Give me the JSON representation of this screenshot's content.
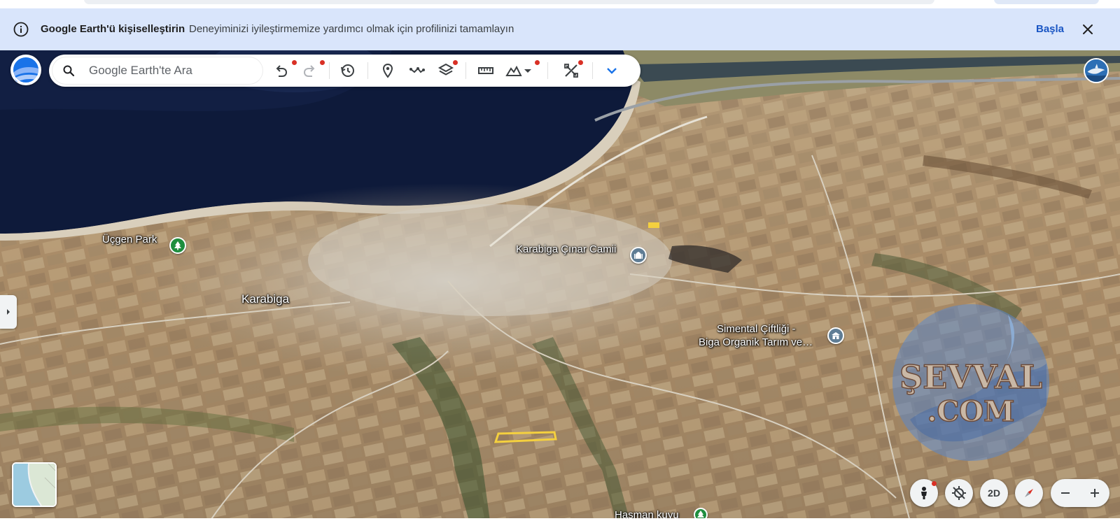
{
  "banner": {
    "title": "Google Earth'ü kişiselleştirin",
    "description": "Deneyiminizi iyileştirmemize yardımcı olmak için profilinizi tamamlayın",
    "start_label": "Başla",
    "info_icon": "info-icon",
    "close_icon": "close-icon"
  },
  "toolbar": {
    "search_placeholder": "Google Earth'te Ara",
    "buttons": [
      "undo-icon",
      "redo-icon",
      "history-icon",
      "placemark-icon",
      "path-icon",
      "layers-icon",
      "ruler-icon",
      "terrain-icon",
      "projects-icon",
      "chevron-down-icon"
    ]
  },
  "map": {
    "labels": {
      "park": "Üçgen Park",
      "mosque": "Karabiga Çınar Camii",
      "town": "Karabiga",
      "farm_line1": "Simental Çiftliği -",
      "farm_line2": "Biga Organik Tarım ve…",
      "well": "Haşman kuyu"
    }
  },
  "controls": {
    "view_2d_label": "2D",
    "zoom_out": "−",
    "zoom_in": "+"
  },
  "watermark": {
    "line1": "ŞEVVAL",
    "line2": ".COM"
  },
  "colors": {
    "banner_bg": "#d9e5fb",
    "accent": "#1a56c4",
    "notification_dot": "#d93025",
    "sea": "#0e1a3a"
  }
}
